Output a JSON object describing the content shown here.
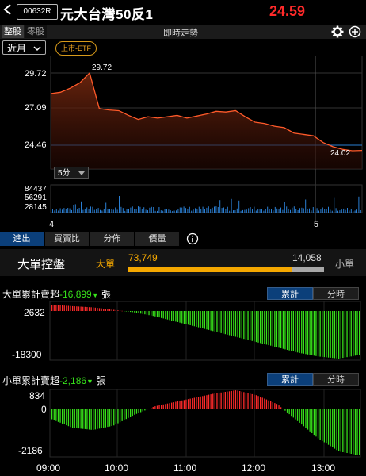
{
  "header": {
    "stock_code": "00632R",
    "stock_name": "元大台灣50反1",
    "price": "24.59"
  },
  "toolbar": {
    "tab_whole": "整股",
    "tab_odd": "零股",
    "title": "即時走勢"
  },
  "filters": {
    "period": "近月",
    "etf_badge": "上市-ETF",
    "interval": "5分"
  },
  "price_chart": {
    "y_ticks": [
      "29.72",
      "27.09",
      "24.46"
    ],
    "peak_label": "29.72",
    "last_label": "24.02",
    "volume_ticks": [
      "84437",
      "56291",
      "28145"
    ],
    "x_ticks": [
      "4",
      "5"
    ]
  },
  "analysis_tabs": [
    "進出",
    "買賣比",
    "分佈",
    "價量"
  ],
  "big_trade": {
    "label": "大單控盤",
    "big_label": "大單",
    "big_value": "73,749",
    "small_value": "14,058",
    "small_label": "小單",
    "big_fraction": 0.84
  },
  "big_cum": {
    "title_prefix": "大單累計賣超",
    "value": "-16,899",
    "unit": "張",
    "btn_cum": "累計",
    "btn_time": "分時",
    "y_ticks": [
      "2632",
      "-18300"
    ]
  },
  "small_cum": {
    "title_prefix": "小單累計賣超",
    "value": "-2,186",
    "unit": "張",
    "btn_cum": "累計",
    "btn_time": "分時",
    "y_ticks": [
      "834",
      "0",
      "-2186"
    ]
  },
  "time_axis": [
    "09:00",
    "10:00",
    "11:00",
    "12:00",
    "13:00"
  ],
  "colors": {
    "up": "#ff2a2a",
    "down": "#37e21a",
    "price_line": "#ff5a2a",
    "volume": "#2a7fd4",
    "accent": "#f5a800"
  },
  "chart_data": [
    {
      "type": "line",
      "series": [
        {
          "values": [
            28.2,
            28.3,
            28.6,
            29.0,
            29.72,
            27.1,
            27.0,
            26.95,
            26.6,
            26.3,
            26.5,
            26.4,
            26.5,
            26.6,
            26.4,
            26.55,
            26.7,
            26.9,
            26.85,
            26.95,
            26.5,
            26.1,
            26.0,
            25.8,
            25.7,
            25.3,
            25.2,
            25.1,
            24.6,
            24.3,
            24.1,
            24.0,
            24.02
          ]
        }
      ],
      "ylim": [
        24.0,
        29.72
      ],
      "x_ticks": [
        "4",
        "5"
      ]
    },
    {
      "type": "bar",
      "values": [
        2632,
        2000,
        1500,
        500,
        -500,
        -2000,
        -4000,
        -6000,
        -8000,
        -10000,
        -12000,
        -14000,
        -16000,
        -17500,
        -18300,
        -16899
      ],
      "ylim": [
        -18300,
        2632
      ]
    },
    {
      "type": "bar",
      "values": [
        -500,
        -900,
        -1000,
        -800,
        -300,
        100,
        300,
        500,
        700,
        834,
        600,
        200,
        -600,
        -1400,
        -2000,
        -2186
      ],
      "ylim": [
        -2186,
        834
      ]
    }
  ]
}
